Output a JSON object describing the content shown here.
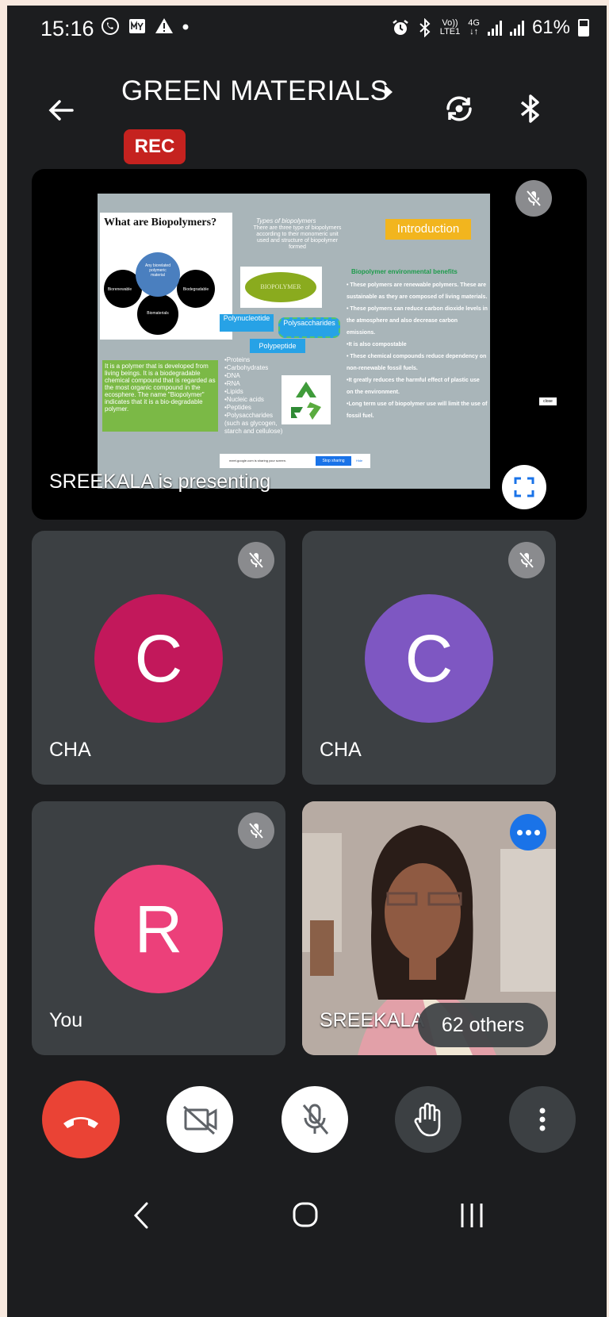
{
  "status_bar": {
    "time": "15:16",
    "volte_top": "Vo))",
    "volte_bottom": "LTE1",
    "network": "4G",
    "battery": "61%"
  },
  "header": {
    "meeting_title": "GREEN MATERIALS",
    "recording_badge": "REC"
  },
  "presentation": {
    "presenting_label": "SREEKALA is presenting",
    "slide": {
      "heading": "What are Biopolymers?",
      "center_circle": "Any biorelated polymeric material",
      "circle_left": "Biorenewable",
      "circle_right": "Biodegradable",
      "circle_bottom": "Biomaterials",
      "types_title": "Types of biopolymers",
      "types_body": "There are three type of biopolymers according to their monomeric unit used and structure of biopolymer formed",
      "intro_label": "Introduction",
      "biopolymer_label": "BIOPOLYMER",
      "polynucleotide": "Polynucleotide",
      "polysaccharides": "Polysaccharides",
      "polypeptide": "Polypeptide",
      "definition": "It is a polymer that is developed from living beings. It is a biodegradable chemical compound that is regarded as the most organic compound in the ecosphere. The name \"Biopolymer\" indicates that it is a bio-degradable polymer.",
      "examples": [
        "•Proteins",
        "•Carbohydrates",
        "•DNA",
        "•RNA",
        "•Lipids",
        "•Nucleic acids",
        "•Peptides",
        "•Polysaccharides (such as glycogen, starch and cellulose)"
      ],
      "benefits_title": "Biopolymer environmental benefits",
      "benefits": [
        "• These polymers are renewable polymers. These are sustainable as they are composed of living materials.",
        "• These polymers can reduce carbon dioxide levels in the atmosphere and also decrease carbon emissions.",
        "•It is also compostable",
        "• These chemical compounds reduce dependency on non-renewable fossil fuels.",
        "•It greatly reduces the harmful effect of plastic use on the environment.",
        "•Long term use of biopolymer use will limit the use of fossil fuel."
      ],
      "share_text": "meet.google.com is sharing your screen.",
      "stop_sharing": "Stop sharing",
      "hide": "Hide",
      "close_tag": "close"
    }
  },
  "participants": [
    {
      "name": "CHA",
      "initial": "C",
      "color": "#c2185b"
    },
    {
      "name": "CHA",
      "initial": "C",
      "color": "#7e57c2"
    },
    {
      "name": "You",
      "initial": "R",
      "color": "#ec407a"
    },
    {
      "name": "SREEKALA"
    }
  ],
  "others_count": "62 others",
  "icons": {
    "status": [
      "whatsapp-icon",
      "myjio-icon",
      "warning-icon",
      "alarm-icon",
      "bluetooth-icon",
      "signal-icon",
      "battery-icon"
    ],
    "header": [
      "back-arrow-icon",
      "switch-camera-icon",
      "bluetooth-icon"
    ],
    "controls": [
      "end-call-icon",
      "camera-off-icon",
      "mic-off-icon",
      "raise-hand-icon",
      "more-vert-icon"
    ],
    "nav": [
      "nav-back-icon",
      "nav-home-icon",
      "nav-recents-icon"
    ]
  }
}
